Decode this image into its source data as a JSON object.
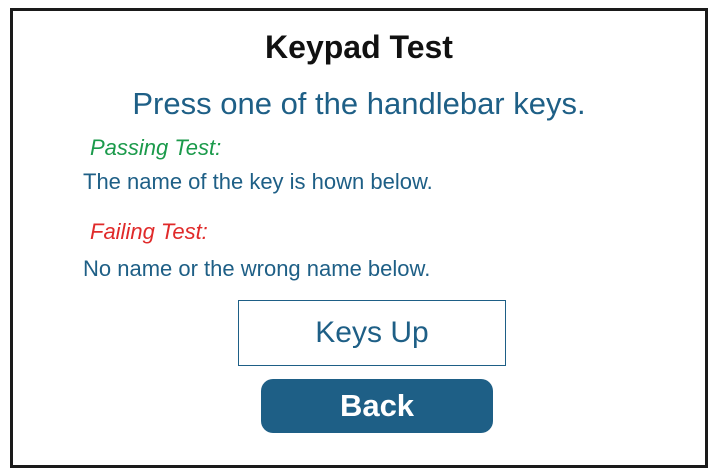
{
  "screen": {
    "title": "Keypad Test",
    "instruction": "Press one of the handlebar keys."
  },
  "passing": {
    "label": "Passing Test:",
    "description": "The name of the key is hown below."
  },
  "failing": {
    "label": "Failing Test:",
    "description": "No name or the wrong name below."
  },
  "key_display": {
    "value": "Keys Up"
  },
  "back_button": {
    "label": "Back"
  },
  "colors": {
    "accent": "#1e5f86",
    "pass": "#1b9a4b",
    "fail": "#e02a2a",
    "title": "#111111",
    "frame_border": "#1a1a1a"
  }
}
